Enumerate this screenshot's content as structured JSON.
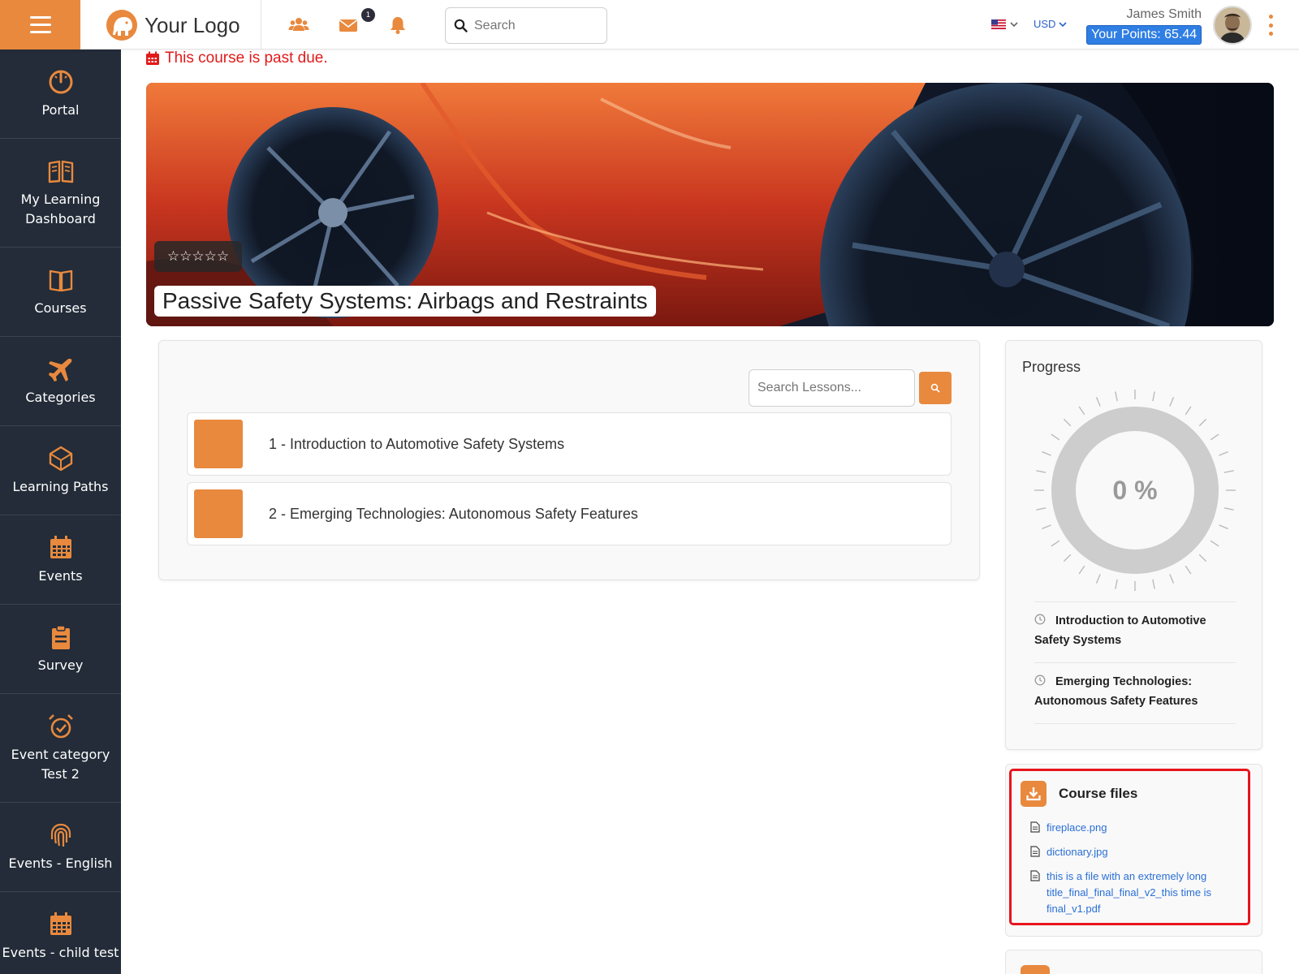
{
  "header": {
    "logo_text": "Your Logo",
    "messages_badge": "1",
    "search_placeholder": "Search",
    "currency": "USD",
    "user_name": "James Smith",
    "points_label": "Your Points: 65.44",
    "accent_color": "#e8893e"
  },
  "sidebar": {
    "items": [
      {
        "label": "Portal",
        "icon": "gauge-icon"
      },
      {
        "label": "My Learning Dashboard",
        "icon": "open-book-icon"
      },
      {
        "label": "Courses",
        "icon": "book-icon"
      },
      {
        "label": "Categories",
        "icon": "airplane-icon"
      },
      {
        "label": "Learning Paths",
        "icon": "cube-icon"
      },
      {
        "label": "Events",
        "icon": "calendar-icon"
      },
      {
        "label": "Survey",
        "icon": "clipboard-icon"
      },
      {
        "label": "Event category Test 2",
        "icon": "alarm-clock-icon"
      },
      {
        "label": "Events - English",
        "icon": "fingerprint-icon"
      },
      {
        "label": "Events - child test",
        "icon": "calendar-icon"
      }
    ]
  },
  "course": {
    "past_due_message": "This course is past due.",
    "title": "Passive Safety Systems: Airbags and Restraints",
    "rating_stars": "☆☆☆☆☆",
    "rating_value": 0
  },
  "lessons": {
    "search_placeholder": "Search Lessons...",
    "items": [
      {
        "label": "1 - Introduction to Automotive Safety Systems"
      },
      {
        "label": "2 - Emerging Technologies: Autonomous Safety Features"
      }
    ]
  },
  "progress": {
    "title": "Progress",
    "percent_label": "0 %",
    "percent_value": 0,
    "items": [
      {
        "label": "Introduction to Automotive Safety Systems"
      },
      {
        "label": "Emerging Technologies: Autonomous Safety Features"
      }
    ]
  },
  "files": {
    "title": "Course files",
    "items": [
      {
        "name": "fireplace.png"
      },
      {
        "name": "dictionary.jpg"
      },
      {
        "name": "this is a file with an extremely long title_final_final_final_v2_this time is final_v1.pdf"
      }
    ]
  }
}
